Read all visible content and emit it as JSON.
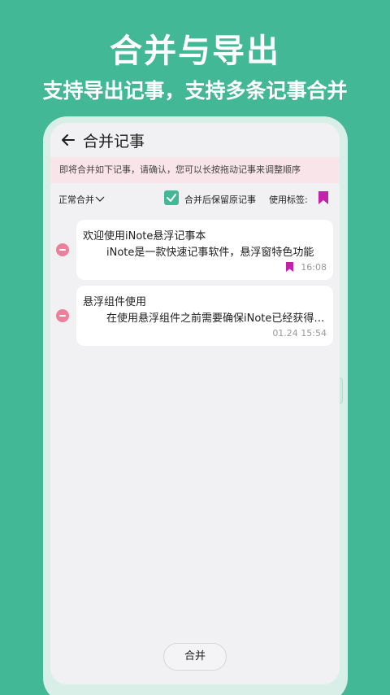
{
  "promo": {
    "title": "合并与导出",
    "subtitle": "支持导出记事，支持多条记事合并"
  },
  "topbar": {
    "title": "合并记事",
    "back_icon": "arrow-left-icon"
  },
  "notice": "即将合并如下记事，请确认，您可以长按拖动记事来调整顺序",
  "options": {
    "mode": "正常合并",
    "keep_original_label": "合并后保留原记事",
    "keep_original_checked": true,
    "use_tag_label": "使用标签:",
    "tag_color": "#c51fae"
  },
  "notes": [
    {
      "title": "欢迎使用iNote悬浮记事本",
      "body": "iNote是一款快速记事软件，悬浮窗特色功能",
      "time": "16:08",
      "has_tag": true
    },
    {
      "title": "悬浮组件使用",
      "body": "在使用悬浮组件之前需要确保iNote已经获得悬浮窗权限",
      "time": "01.24 15:54",
      "has_tag": false
    }
  ],
  "merge_button": "合并",
  "colors": {
    "background": "#43b896",
    "accent": "#43b896",
    "notice_bg": "#f9e4ea",
    "remove": "#ec7f9a"
  }
}
